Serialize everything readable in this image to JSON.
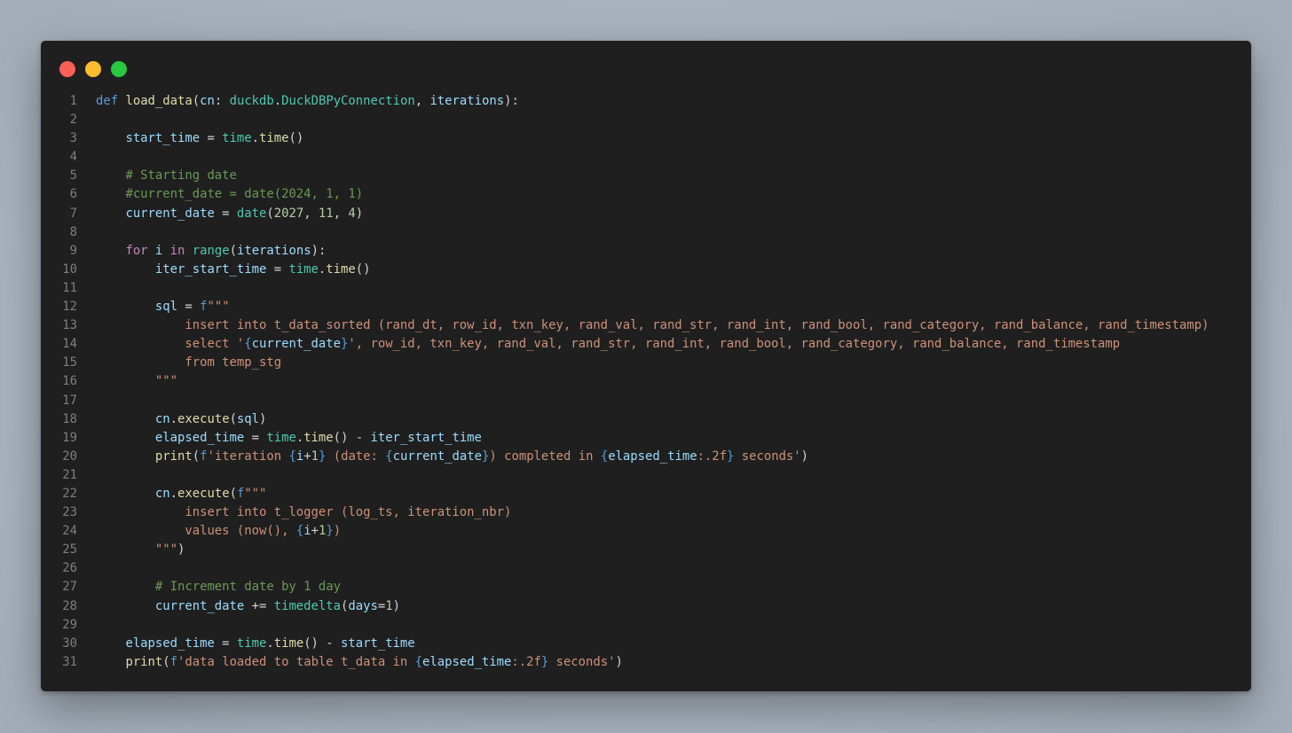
{
  "window": {
    "controls": [
      "close",
      "minimize",
      "maximize"
    ]
  },
  "code": {
    "language": "python",
    "lines": [
      [
        {
          "t": "def",
          "c": "k"
        },
        {
          "t": " ",
          "c": "p"
        },
        {
          "t": "load_data",
          "c": "fn"
        },
        {
          "t": "(",
          "c": "p"
        },
        {
          "t": "cn",
          "c": "v"
        },
        {
          "t": ": ",
          "c": "p"
        },
        {
          "t": "duckdb",
          "c": "t"
        },
        {
          "t": ".",
          "c": "p"
        },
        {
          "t": "DuckDBPyConnection",
          "c": "t"
        },
        {
          "t": ", ",
          "c": "p"
        },
        {
          "t": "iterations",
          "c": "v"
        },
        {
          "t": "):",
          "c": "p"
        }
      ],
      [],
      [
        {
          "t": "    ",
          "c": "p"
        },
        {
          "t": "start_time",
          "c": "v"
        },
        {
          "t": " = ",
          "c": "p"
        },
        {
          "t": "time",
          "c": "t"
        },
        {
          "t": ".",
          "c": "p"
        },
        {
          "t": "time",
          "c": "fn"
        },
        {
          "t": "()",
          "c": "p"
        }
      ],
      [],
      [
        {
          "t": "    # Starting date",
          "c": "c"
        }
      ],
      [
        {
          "t": "    #current_date = date(2024, 1, 1)",
          "c": "c"
        }
      ],
      [
        {
          "t": "    ",
          "c": "p"
        },
        {
          "t": "current_date",
          "c": "v"
        },
        {
          "t": " = ",
          "c": "p"
        },
        {
          "t": "date",
          "c": "t"
        },
        {
          "t": "(",
          "c": "p"
        },
        {
          "t": "2027",
          "c": "n"
        },
        {
          "t": ", ",
          "c": "p"
        },
        {
          "t": "11",
          "c": "n"
        },
        {
          "t": ", ",
          "c": "p"
        },
        {
          "t": "4",
          "c": "n"
        },
        {
          "t": ")",
          "c": "p"
        }
      ],
      [],
      [
        {
          "t": "    ",
          "c": "p"
        },
        {
          "t": "for",
          "c": "kc"
        },
        {
          "t": " ",
          "c": "p"
        },
        {
          "t": "i",
          "c": "v"
        },
        {
          "t": " ",
          "c": "p"
        },
        {
          "t": "in",
          "c": "kc"
        },
        {
          "t": " ",
          "c": "p"
        },
        {
          "t": "range",
          "c": "t"
        },
        {
          "t": "(",
          "c": "p"
        },
        {
          "t": "iterations",
          "c": "v"
        },
        {
          "t": "):",
          "c": "p"
        }
      ],
      [
        {
          "t": "        ",
          "c": "p"
        },
        {
          "t": "iter_start_time",
          "c": "v"
        },
        {
          "t": " = ",
          "c": "p"
        },
        {
          "t": "time",
          "c": "t"
        },
        {
          "t": ".",
          "c": "p"
        },
        {
          "t": "time",
          "c": "fn"
        },
        {
          "t": "()",
          "c": "p"
        }
      ],
      [],
      [
        {
          "t": "        ",
          "c": "p"
        },
        {
          "t": "sql",
          "c": "v"
        },
        {
          "t": " = ",
          "c": "p"
        },
        {
          "t": "f",
          "c": "k"
        },
        {
          "t": "\"\"\"",
          "c": "s"
        }
      ],
      [
        {
          "t": "            insert into t_data_sorted (rand_dt, row_id, txn_key, rand_val, rand_str, rand_int, rand_bool, rand_category, rand_balance, rand_timestamp)",
          "c": "s"
        }
      ],
      [
        {
          "t": "            select '",
          "c": "s"
        },
        {
          "t": "{",
          "c": "b"
        },
        {
          "t": "current_date",
          "c": "v"
        },
        {
          "t": "}",
          "c": "b"
        },
        {
          "t": "', row_id, txn_key, rand_val, rand_str, rand_int, rand_bool, rand_category, rand_balance, rand_timestamp",
          "c": "s"
        }
      ],
      [
        {
          "t": "            from temp_stg",
          "c": "s"
        }
      ],
      [
        {
          "t": "        \"\"\"",
          "c": "s"
        }
      ],
      [],
      [
        {
          "t": "        ",
          "c": "p"
        },
        {
          "t": "cn",
          "c": "v"
        },
        {
          "t": ".",
          "c": "p"
        },
        {
          "t": "execute",
          "c": "fn"
        },
        {
          "t": "(",
          "c": "p"
        },
        {
          "t": "sql",
          "c": "v"
        },
        {
          "t": ")",
          "c": "p"
        }
      ],
      [
        {
          "t": "        ",
          "c": "p"
        },
        {
          "t": "elapsed_time",
          "c": "v"
        },
        {
          "t": " = ",
          "c": "p"
        },
        {
          "t": "time",
          "c": "t"
        },
        {
          "t": ".",
          "c": "p"
        },
        {
          "t": "time",
          "c": "fn"
        },
        {
          "t": "() - ",
          "c": "p"
        },
        {
          "t": "iter_start_time",
          "c": "v"
        }
      ],
      [
        {
          "t": "        ",
          "c": "p"
        },
        {
          "t": "print",
          "c": "fn"
        },
        {
          "t": "(",
          "c": "p"
        },
        {
          "t": "f",
          "c": "k"
        },
        {
          "t": "'iteration ",
          "c": "s"
        },
        {
          "t": "{",
          "c": "b"
        },
        {
          "t": "i",
          "c": "v"
        },
        {
          "t": "+",
          "c": "p"
        },
        {
          "t": "1",
          "c": "n"
        },
        {
          "t": "}",
          "c": "b"
        },
        {
          "t": " (date: ",
          "c": "s"
        },
        {
          "t": "{",
          "c": "b"
        },
        {
          "t": "current_date",
          "c": "v"
        },
        {
          "t": "}",
          "c": "b"
        },
        {
          "t": ") completed in ",
          "c": "s"
        },
        {
          "t": "{",
          "c": "b"
        },
        {
          "t": "elapsed_time",
          "c": "v"
        },
        {
          "t": ":.2f",
          "c": "s"
        },
        {
          "t": "}",
          "c": "b"
        },
        {
          "t": " seconds'",
          "c": "s"
        },
        {
          "t": ")",
          "c": "p"
        }
      ],
      [],
      [
        {
          "t": "        ",
          "c": "p"
        },
        {
          "t": "cn",
          "c": "v"
        },
        {
          "t": ".",
          "c": "p"
        },
        {
          "t": "execute",
          "c": "fn"
        },
        {
          "t": "(",
          "c": "p"
        },
        {
          "t": "f",
          "c": "k"
        },
        {
          "t": "\"\"\"",
          "c": "s"
        }
      ],
      [
        {
          "t": "            insert into t_logger (log_ts, iteration_nbr)",
          "c": "s"
        }
      ],
      [
        {
          "t": "            values (now(), ",
          "c": "s"
        },
        {
          "t": "{",
          "c": "b"
        },
        {
          "t": "i",
          "c": "v"
        },
        {
          "t": "+",
          "c": "p"
        },
        {
          "t": "1",
          "c": "n"
        },
        {
          "t": "}",
          "c": "b"
        },
        {
          "t": ")",
          "c": "s"
        }
      ],
      [
        {
          "t": "        \"\"\"",
          "c": "s"
        },
        {
          "t": ")",
          "c": "p"
        }
      ],
      [],
      [
        {
          "t": "        # Increment date by 1 day",
          "c": "c"
        }
      ],
      [
        {
          "t": "        ",
          "c": "p"
        },
        {
          "t": "current_date",
          "c": "v"
        },
        {
          "t": " += ",
          "c": "p"
        },
        {
          "t": "timedelta",
          "c": "t"
        },
        {
          "t": "(",
          "c": "p"
        },
        {
          "t": "days",
          "c": "v"
        },
        {
          "t": "=",
          "c": "p"
        },
        {
          "t": "1",
          "c": "n"
        },
        {
          "t": ")",
          "c": "p"
        }
      ],
      [],
      [
        {
          "t": "    ",
          "c": "p"
        },
        {
          "t": "elapsed_time",
          "c": "v"
        },
        {
          "t": " = ",
          "c": "p"
        },
        {
          "t": "time",
          "c": "t"
        },
        {
          "t": ".",
          "c": "p"
        },
        {
          "t": "time",
          "c": "fn"
        },
        {
          "t": "() - ",
          "c": "p"
        },
        {
          "t": "start_time",
          "c": "v"
        }
      ],
      [
        {
          "t": "    ",
          "c": "p"
        },
        {
          "t": "print",
          "c": "fn"
        },
        {
          "t": "(",
          "c": "p"
        },
        {
          "t": "f",
          "c": "k"
        },
        {
          "t": "'data loaded to table t_data in ",
          "c": "s"
        },
        {
          "t": "{",
          "c": "b"
        },
        {
          "t": "elapsed_time",
          "c": "v"
        },
        {
          "t": ":.2f",
          "c": "s"
        },
        {
          "t": "}",
          "c": "b"
        },
        {
          "t": " seconds'",
          "c": "s"
        },
        {
          "t": ")",
          "c": "p"
        }
      ]
    ]
  }
}
